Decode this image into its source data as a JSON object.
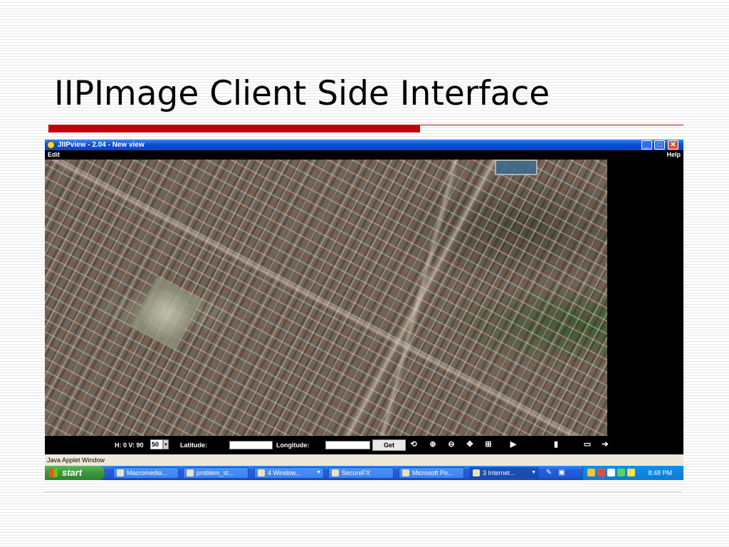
{
  "slide": {
    "title": "IIPImage Client Side Interface"
  },
  "window": {
    "title": "JIIPview - 2.04 - New view",
    "controls": {
      "minimize": "_",
      "maximize": "□",
      "close": "✕"
    }
  },
  "menu": {
    "edit": "Edit",
    "help": "Help"
  },
  "toolbar": {
    "hv_readout": "H: 0 V: 90",
    "zoom_value": "50",
    "latitude_label": "Latitude:",
    "longitude_label": "Longitude:",
    "get_label": "Get",
    "icons": [
      {
        "name": "refresh-icon",
        "glyph": "⟲"
      },
      {
        "name": "zoom-in-icon",
        "glyph": "⊕"
      },
      {
        "name": "zoom-out-icon",
        "glyph": "⊖"
      },
      {
        "name": "pan-icon",
        "glyph": "✥"
      },
      {
        "name": "fit-icon",
        "glyph": "⊞"
      },
      {
        "name": "region-icon",
        "glyph": "▶"
      },
      {
        "name": "marker-icon",
        "glyph": "▮"
      },
      {
        "name": "save-icon",
        "glyph": "▭"
      },
      {
        "name": "exit-icon",
        "glyph": "➔"
      }
    ]
  },
  "status": {
    "text": "Java Applet Window"
  },
  "taskbar": {
    "start_label": "start",
    "items": [
      {
        "label": "Macromedia...",
        "has_dropdown": false
      },
      {
        "label": "problem_st...",
        "has_dropdown": false
      },
      {
        "label": "4 Window...",
        "has_dropdown": true
      },
      {
        "label": "SecureFX",
        "has_dropdown": false
      },
      {
        "label": "Microsoft Po...",
        "has_dropdown": false
      },
      {
        "label": "3 Internet...",
        "has_dropdown": true
      }
    ],
    "clock": "8:48 PM"
  },
  "colors": {
    "accent_red": "#c0000c",
    "xp_blue": "#245edb",
    "start_green": "#3c9a3c"
  }
}
